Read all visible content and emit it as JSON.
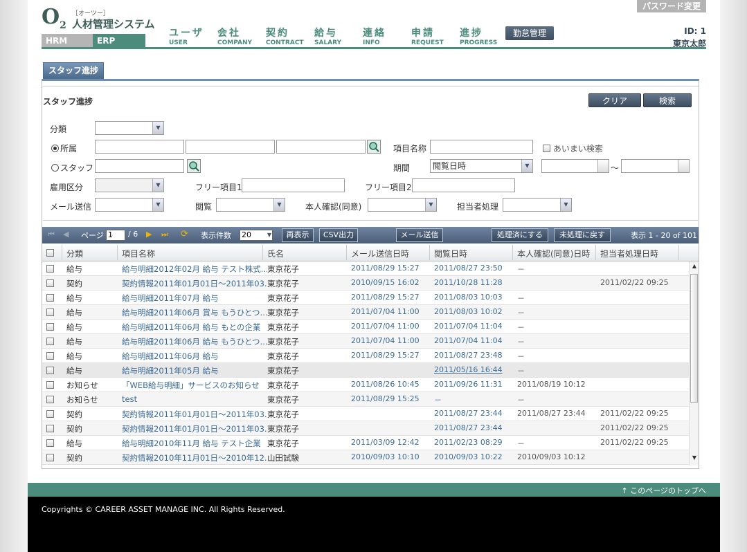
{
  "header": {
    "password_button": "パスワード変更",
    "logo_main": "O",
    "logo_sub": "2",
    "logo_ruby": "［オーツー］",
    "logo_title": "人材管理システム",
    "system_tabs": [
      "HRM",
      "ERP"
    ],
    "nav": [
      {
        "jp": "ユーザ",
        "en": "USER"
      },
      {
        "jp": "会社",
        "en": "COMPANY"
      },
      {
        "jp": "契約",
        "en": "CONTRACT"
      },
      {
        "jp": "給与",
        "en": "SALARY"
      },
      {
        "jp": "連絡",
        "en": "INFO"
      },
      {
        "jp": "申請",
        "en": "REQUEST"
      },
      {
        "jp": "進捗",
        "en": "PROGRESS"
      }
    ],
    "kintai_button": "勤怠管理",
    "user_id": "ID: 1",
    "user_name": "東京太郎"
  },
  "tab": "スタッフ進捗",
  "search": {
    "title": "スタッフ進捗",
    "clear_button": "クリア",
    "search_button": "検索",
    "category_label": "分類",
    "affiliation_label": "所属",
    "staff_label": "スタッフ",
    "employment_label": "雇用区分",
    "mail_label": "メール送信",
    "item_name_label": "項目名称",
    "fuzzy_label": "あいまい検索",
    "period_label": "期間",
    "period_value": "閲覧日時",
    "tilde": "～",
    "free1_label": "フリー項目1",
    "free2_label": "フリー項目2",
    "view_label": "閲覧",
    "confirm_label": "本人確認(同意)",
    "handler_label": "担当者処理"
  },
  "toolbar": {
    "page_label": "ページ",
    "page_value": "1",
    "page_total": "/ 6",
    "count_label": "表示件数",
    "count_value": "20",
    "refresh": "再表示",
    "csv": "CSV出力",
    "mail": "メール送信",
    "processed": "処理済にする",
    "unprocessed": "未処理に戻す",
    "display_info": "表示 1 - 20 of 101"
  },
  "table": {
    "headers": [
      "分類",
      "項目名称",
      "氏名",
      "メール送信日時",
      "閲覧日時",
      "本人確認(同意)日時",
      "担当者処理日時"
    ],
    "rows": [
      {
        "cat": "給与",
        "name": "給与明細2012年02月 給与 テスト株式...",
        "staff": "東京花子",
        "mail": "2011/08/29 15:27",
        "view": "2011/08/27 23:50",
        "confirm": "－",
        "proc": ""
      },
      {
        "cat": "契約",
        "name": "契約情報2011年01月01日～2011年03...",
        "staff": "東京花子",
        "mail": "2010/09/15 16:02",
        "view": "2011/10/28 11:28",
        "confirm": "",
        "proc": "2011/02/22 09:25"
      },
      {
        "cat": "給与",
        "name": "給与明細2011年07月 給与",
        "staff": "東京花子",
        "mail": "2011/08/29 15:27",
        "view": "2011/08/03 10:03",
        "confirm": "－",
        "proc": ""
      },
      {
        "cat": "給与",
        "name": "給与明細2011年06月 賞与 もうひとつ...",
        "staff": "東京花子",
        "mail": "2011/07/04 11:00",
        "view": "2011/08/03 10:02",
        "confirm": "－",
        "proc": ""
      },
      {
        "cat": "給与",
        "name": "給与明細2011年06月 給与 もとの企業",
        "staff": "東京花子",
        "mail": "2011/07/04 11:00",
        "view": "2011/07/04 11:04",
        "confirm": "－",
        "proc": ""
      },
      {
        "cat": "給与",
        "name": "給与明細2011年06月 給与 もうひとつ...",
        "staff": "東京花子",
        "mail": "2011/07/04 11:00",
        "view": "2011/07/04 11:04",
        "confirm": "－",
        "proc": ""
      },
      {
        "cat": "給与",
        "name": "給与明細2011年06月 給与",
        "staff": "東京花子",
        "mail": "2011/08/29 15:27",
        "view": "2011/08/27 23:48",
        "confirm": "－",
        "proc": ""
      },
      {
        "cat": "給与",
        "name": "給与明細2011年05月 給与",
        "staff": "東京花子",
        "mail": "",
        "view": "2011/05/16 16:44",
        "confirm": "－",
        "proc": ""
      },
      {
        "cat": "お知らせ",
        "name": "「WEB給与明細」サービスのお知らせ",
        "staff": "東京花子",
        "mail": "2011/08/26 10:45",
        "view": "2011/09/26 11:31",
        "confirm": "2011/08/19 10:12",
        "proc": ""
      },
      {
        "cat": "お知らせ",
        "name": "test",
        "staff": "東京花子",
        "mail": "2011/08/29 15:25",
        "view": "－",
        "confirm": "－",
        "proc": ""
      },
      {
        "cat": "契約",
        "name": "契約情報2011年01月01日～2011年03...",
        "staff": "東京花子",
        "mail": "",
        "view": "2011/08/27 23:44",
        "confirm": "2011/08/27 23:44",
        "proc": "2011/02/22 09:25"
      },
      {
        "cat": "契約",
        "name": "契約情報2011年01月01日～2011年03...",
        "staff": "東京花子",
        "mail": "",
        "view": "2011/08/27 23:44",
        "confirm": "",
        "proc": "2011/02/22 09:25"
      },
      {
        "cat": "給与",
        "name": "給与明細2010年11月 給与 テスト企業",
        "staff": "東京花子",
        "mail": "2011/03/09 12:42",
        "view": "2011/02/23 08:29",
        "confirm": "－",
        "proc": "2011/02/22 09:25"
      },
      {
        "cat": "契約",
        "name": "契約情報2010年11月01日～2010年12...",
        "staff": "山田試験",
        "mail": "2010/09/03 10:10",
        "view": "2010/09/03 10:22",
        "confirm": "2010/09/03 10:12",
        "proc": ""
      }
    ]
  },
  "footer": {
    "page_top": "このページのトップへ",
    "copyright": "Copyrights © CAREER ASSET MANAGE INC. All Rights Reserved."
  },
  "colors": {
    "accent": "#4b8c7c",
    "toolbar": "#5a6f8a",
    "link": "#3a6a96"
  }
}
